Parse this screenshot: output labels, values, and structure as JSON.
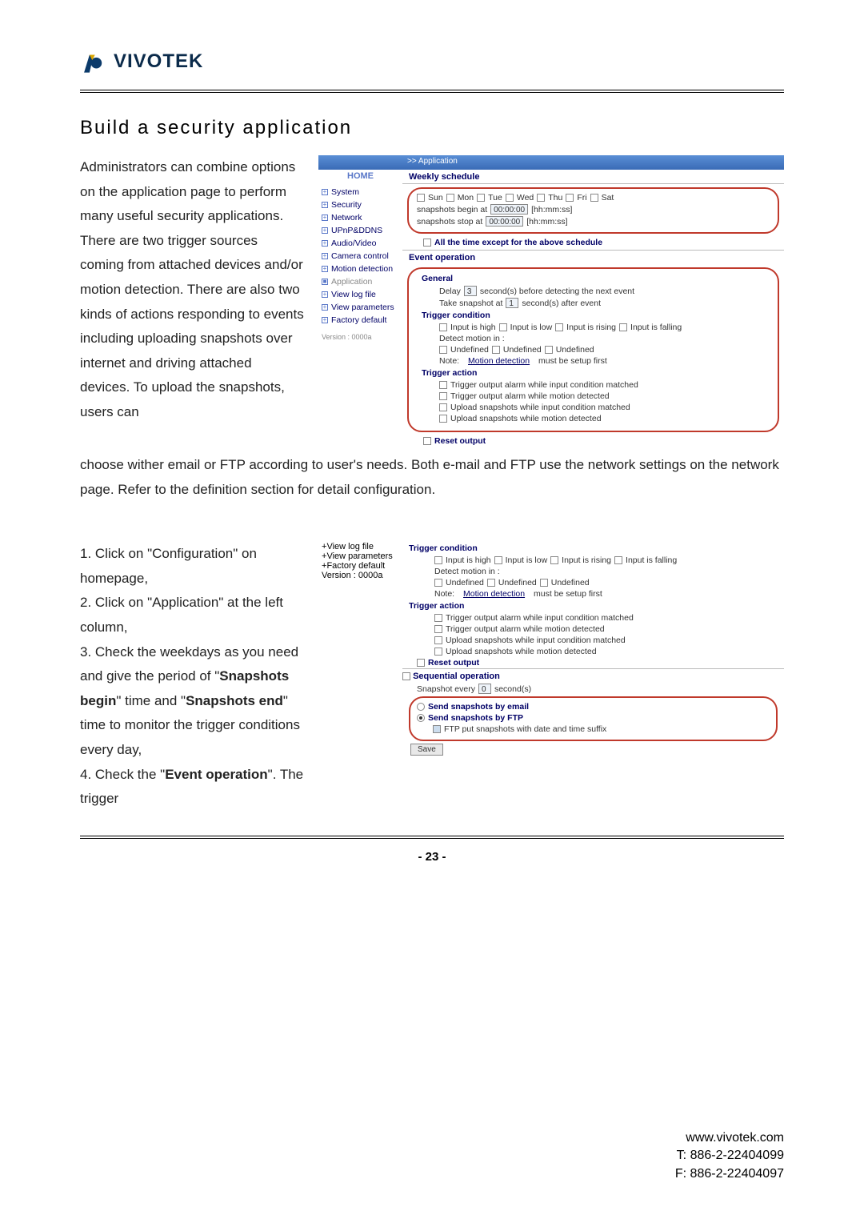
{
  "logo": {
    "text": "VIVOTEK"
  },
  "hr": {},
  "title": "Build a security application",
  "para1": "Administrators can combine options on the application page to perform many useful security applications. There are two trigger sources coming from attached devices and/or motion detection. There are also two kinds of actions responding to events including uploading snapshots over internet and driving attached devices. To upload the snapshots, users can",
  "para1_cont": "choose wither email or FTP according to user's needs. Both e-mail and FTP use the network settings on the network page. Refer to the definition section for detail configuration.",
  "steps": {
    "s1": "1. Click on \"Configuration\" on homepage,",
    "s2": "2. Click on \"Application\" at the left column,",
    "s3a": "3. Check the weekdays as you need and give the period of \"",
    "s3b": "Snapshots begin",
    "s3c": "\" time and \"",
    "s3d": "Snapshots end",
    "s3e": "\" time to monitor the trigger conditions every day,",
    "s4a": "4. Check the \"",
    "s4b": "Event operation",
    "s4c": "\". The trigger"
  },
  "app": {
    "header": ">> Application",
    "homeLabel": "HOME",
    "nav": {
      "system": "System",
      "security": "Security",
      "network": "Network",
      "upnp": "UPnP&DDNS",
      "av": "Audio/Video",
      "camera": "Camera control",
      "motion": "Motion detection",
      "application": "Application",
      "viewlog": "View log file",
      "viewparams": "View parameters",
      "factory": "Factory default"
    },
    "version": "Version : 0000a",
    "weeklySchedule": "Weekly schedule",
    "days": {
      "sun": "Sun",
      "mon": "Mon",
      "tue": "Tue",
      "wed": "Wed",
      "thu": "Thu",
      "fri": "Fri",
      "sat": "Sat"
    },
    "snapBeginLabel": "snapshots begin at",
    "snapBeginVal": "00:00:00",
    "snapBeginHint": "[hh:mm:ss]",
    "snapStopLabel": "snapshots stop at",
    "snapStopVal": "00:00:00",
    "snapStopHint": "[hh:mm:ss]",
    "allTimeLabel": "All the time except for the above schedule",
    "eventOp": "Event operation",
    "general": "General",
    "delayLabel": "Delay",
    "delayVal": "3",
    "delayAfter": "second(s) before detecting the next event",
    "takeSnapLabel": "Take snapshot at",
    "takeSnapVal": "1",
    "takeSnapAfter": "second(s) after event",
    "trigCond": "Trigger condition",
    "inHigh": "Input is high",
    "inLow": "Input is low",
    "inRise": "Input is rising",
    "inFall": "Input is falling",
    "detectIn": "Detect motion in :",
    "undef": "Undefined",
    "noteLabel": "Note:",
    "noteLink": "Motion detection",
    "noteAfter": "must be setup first",
    "trigAct": "Trigger action",
    "ta1": "Trigger output alarm while input condition matched",
    "ta2": "Trigger output alarm while motion detected",
    "ta3": "Upload snapshots while input condition matched",
    "ta4": "Upload snapshots while motion detected",
    "resetOut": "Reset output",
    "seqOp": "Sequential operation",
    "snapEveryLabel": "Snapshot every",
    "snapEveryVal": "0",
    "snapEveryAfter": "second(s)",
    "sendEmail": "Send snapshots by email",
    "sendFtp": "Send snapshots by FTP",
    "ftpSuffix": "FTP put snapshots with date and time suffix",
    "save": "Save"
  },
  "pageNum": "- 23 -",
  "footer": {
    "url": "www.vivotek.com",
    "tel": "T: 886-2-22404099",
    "fax": "F: 886-2-22404097"
  }
}
